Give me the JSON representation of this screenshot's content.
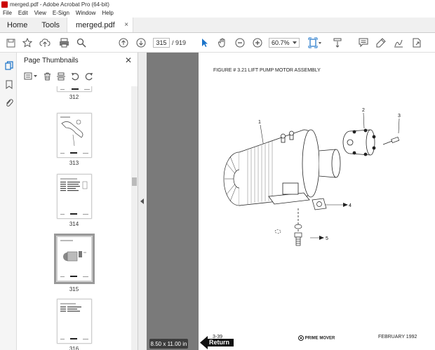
{
  "window": {
    "title": "merged.pdf - Adobe Acrobat Pro (64-bit)"
  },
  "menu": [
    "File",
    "Edit",
    "View",
    "E-Sign",
    "Window",
    "Help"
  ],
  "tabs": {
    "home": "Home",
    "tools": "Tools",
    "document": "merged.pdf",
    "close_glyph": "×"
  },
  "toolbar": {
    "page_current": "315",
    "page_total": "/ 919",
    "zoom": "60.7%"
  },
  "panel": {
    "title": "Page Thumbnails",
    "close_glyph": "✕",
    "thumbnails": [
      {
        "label": "312"
      },
      {
        "label": "313"
      },
      {
        "label": "314"
      },
      {
        "label": "315",
        "selected": true
      },
      {
        "label": "316"
      }
    ]
  },
  "pdf": {
    "figure_title": "FIGURE # 3.21  LIFT PUMP MOTOR ASSEMBLY",
    "callouts": [
      "1",
      "2",
      "3",
      "4",
      "5"
    ],
    "footer_left": "3-39",
    "footer_brand": "PRIME MOVER",
    "footer_right": "FEBRUARY 1992"
  },
  "status": {
    "page_size": "8.50 x 11.00 in",
    "return_label": "Return"
  }
}
